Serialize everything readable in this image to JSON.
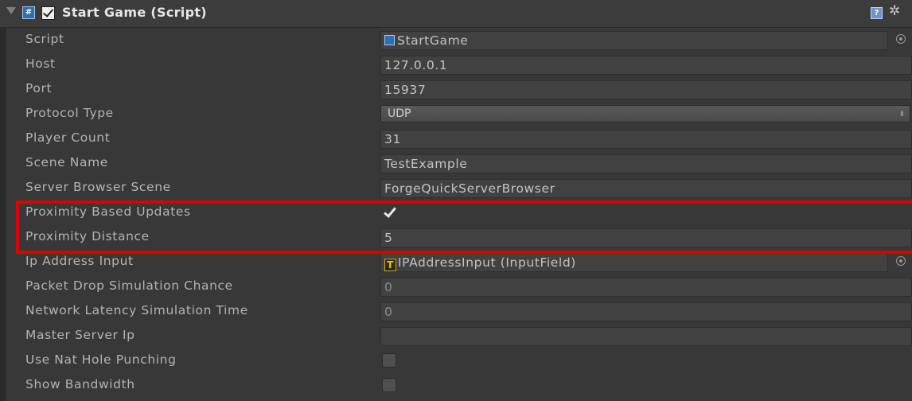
{
  "component": {
    "title": "Start Game (Script)",
    "enabled": true,
    "icons": [
      "foldout-arrow",
      "csharp-script-icon",
      "help-icon",
      "gear-icon"
    ]
  },
  "fields": [
    {
      "label": "Script",
      "value": "StartGame",
      "kind": "object",
      "object_icon": "csharp-script-icon"
    },
    {
      "label": "Host",
      "value": "127.0.0.1",
      "kind": "text"
    },
    {
      "label": "Port",
      "value": "15937",
      "kind": "text"
    },
    {
      "label": "Protocol Type",
      "value": "UDP",
      "kind": "dropdown"
    },
    {
      "label": "Player Count",
      "value": "31",
      "kind": "text"
    },
    {
      "label": "Scene Name",
      "value": "TestExample",
      "kind": "text"
    },
    {
      "label": "Server Browser Scene",
      "value": "ForgeQuickServerBrowser",
      "kind": "text"
    },
    {
      "label": "Proximity Based Updates",
      "value": true,
      "kind": "checkbox"
    },
    {
      "label": "Proximity Distance",
      "value": "5",
      "kind": "text"
    },
    {
      "label": "Ip Address Input",
      "value": "IPAddressInput (InputField)",
      "kind": "object",
      "object_icon": "text-icon"
    },
    {
      "label": "Packet Drop Simulation Chance",
      "value": "0",
      "kind": "text"
    },
    {
      "label": "Network Latency Simulation Time",
      "value": "0",
      "kind": "text"
    },
    {
      "label": "Master Server Ip",
      "value": "",
      "kind": "text"
    },
    {
      "label": "Use Nat Hole Punching",
      "value": false,
      "kind": "checkbox"
    },
    {
      "label": "Show Bandwidth",
      "value": false,
      "kind": "checkbox"
    }
  ],
  "icon_glyphs": {
    "csharp": "#",
    "text": "T",
    "help": "?",
    "gear": "✲"
  },
  "colors": {
    "background": "#383838",
    "field": "#414141",
    "highlight": "#e00000"
  }
}
